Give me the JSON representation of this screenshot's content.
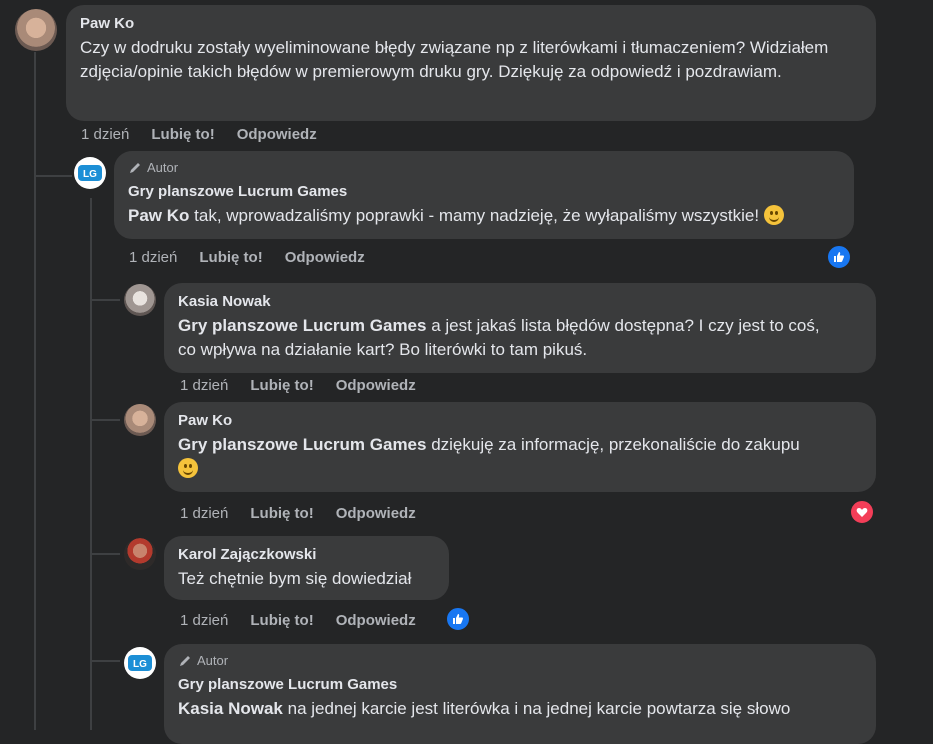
{
  "comments": [
    {
      "author": "Paw Ko",
      "text": "Czy w dodruku zostały wyeliminowane błędy związane np z literówkami i tłumaczeniem? Widziałem zdjęcia/opinie takich błędów w premierowym druku gry. Dziękuję za odpowiedź i pozdrawiam.",
      "time": "1 dzień",
      "like": "Lubię to!",
      "reply": "Odpowiedz"
    },
    {
      "author_tag": "Autor",
      "author": "Gry planszowe Lucrum Games",
      "mention": "Paw Ko",
      "text": "tak, wprowadzaliśmy poprawki - mamy nadzieję, że wyłapaliśmy wszystkie!",
      "time": "1 dzień",
      "like": "Lubię to!",
      "reply": "Odpowiedz",
      "reaction": "like"
    },
    {
      "author": "Kasia Nowak",
      "mention": "Gry planszowe Lucrum Games",
      "text_line1": "a jest jakaś lista błędów dostępna? I czy jest to coś,",
      "text_line2": "co wpływa na działanie kart? Bo literówki to tam pikuś.",
      "time": "1 dzień",
      "like": "Lubię to!",
      "reply": "Odpowiedz"
    },
    {
      "author": "Paw Ko",
      "mention": "Gry planszowe Lucrum Games",
      "text": "dziękuję za informację, przekonaliście do zakupu",
      "time": "1 dzień",
      "like": "Lubię to!",
      "reply": "Odpowiedz",
      "reaction": "love"
    },
    {
      "author": "Karol Zajączkowski",
      "text": "Też chętnie bym się dowiedział",
      "time": "1 dzień",
      "like": "Lubię to!",
      "reply": "Odpowiedz",
      "reaction": "like"
    },
    {
      "author_tag": "Autor",
      "author": "Gry planszowe Lucrum Games",
      "mention": "Kasia Nowak",
      "text": "na jednej karcie jest literówka i na jednej karcie powtarza się słowo"
    }
  ],
  "colors": {
    "background": "#242526",
    "bubble": "#3a3b3c",
    "like_blue": "#1877f2",
    "love_red": "#f33e58"
  }
}
